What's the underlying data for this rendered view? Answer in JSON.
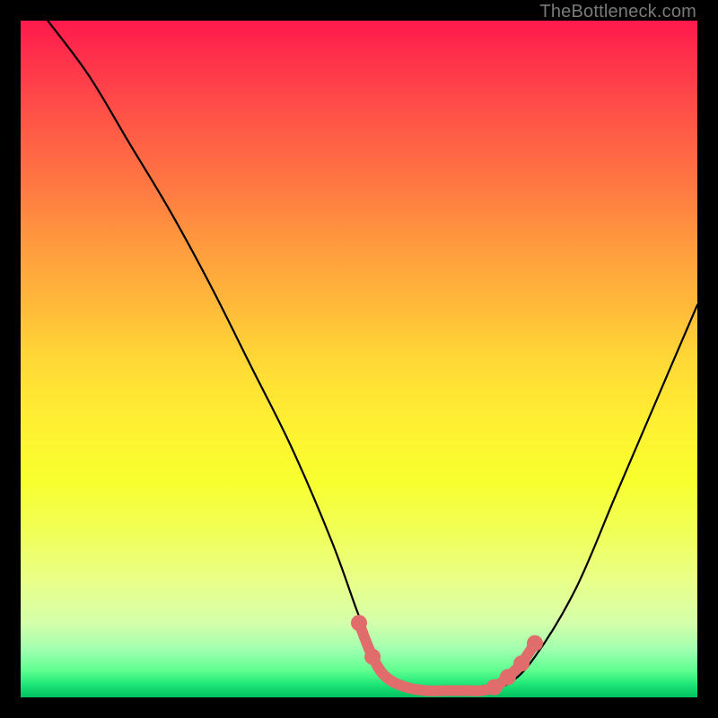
{
  "attribution": "TheBottleneck.com",
  "chart_data": {
    "type": "line",
    "title": "",
    "xlabel": "",
    "ylabel": "",
    "xlim": [
      0,
      100
    ],
    "ylim": [
      0,
      100
    ],
    "grid": false,
    "legend": false,
    "series": [
      {
        "name": "curve",
        "color": "#000000",
        "x": [
          4,
          10,
          16,
          22,
          28,
          34,
          40,
          46,
          50,
          53,
          56,
          60,
          64,
          68,
          72,
          76,
          82,
          88,
          94,
          100
        ],
        "y": [
          100,
          92,
          82,
          72,
          61,
          49,
          37,
          23,
          12,
          5,
          2,
          1,
          1,
          1,
          2,
          6,
          16,
          30,
          44,
          58
        ]
      },
      {
        "name": "highlight",
        "color": "#e06c6c",
        "x": [
          50,
          52,
          54,
          57,
          60,
          63,
          66,
          68,
          70,
          72,
          74,
          76
        ],
        "y": [
          11,
          6,
          3,
          1.5,
          1,
          1,
          1,
          1,
          1.5,
          3,
          5,
          8
        ]
      }
    ],
    "highlight_markers": {
      "color": "#e06c6c",
      "points": [
        {
          "x": 50,
          "y": 11
        },
        {
          "x": 52,
          "y": 6
        },
        {
          "x": 70,
          "y": 1.5
        },
        {
          "x": 72,
          "y": 3
        },
        {
          "x": 74,
          "y": 5
        },
        {
          "x": 76,
          "y": 8
        }
      ]
    }
  }
}
